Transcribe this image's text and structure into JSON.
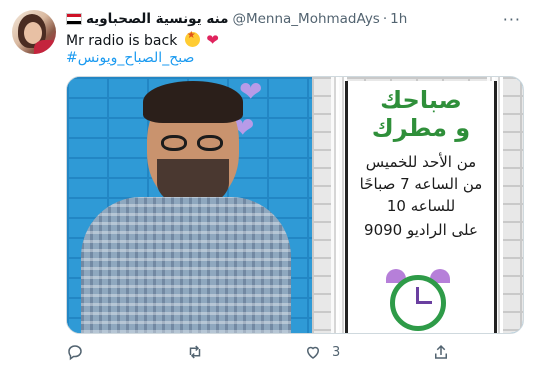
{
  "tweet": {
    "display_name": "منه يونسية الصحباويه",
    "handle": "@Menna_MohmadAys",
    "separator": "·",
    "time": "1h",
    "more_label": "···",
    "text": "Mr radio is back",
    "hashtag": "#صبح_الصباح_ويونس",
    "emojis": [
      "star-struck-emoji",
      "red-heart-emoji"
    ],
    "flag_colors": [
      "#ce1126",
      "#ffffff",
      "#000000"
    ]
  },
  "media": {
    "title_line1": "صباحك",
    "title_line2": "و مطرك",
    "line1": "من الأحد للخميس",
    "line2": "من الساعه 7 صباحًا",
    "line3": "للساعه 10",
    "line4": "على الراديو 9090",
    "accent_color": "#2f8f3a"
  },
  "actions": {
    "reply_count": "",
    "retweet_count": "",
    "like_count": "3",
    "share_count": ""
  }
}
